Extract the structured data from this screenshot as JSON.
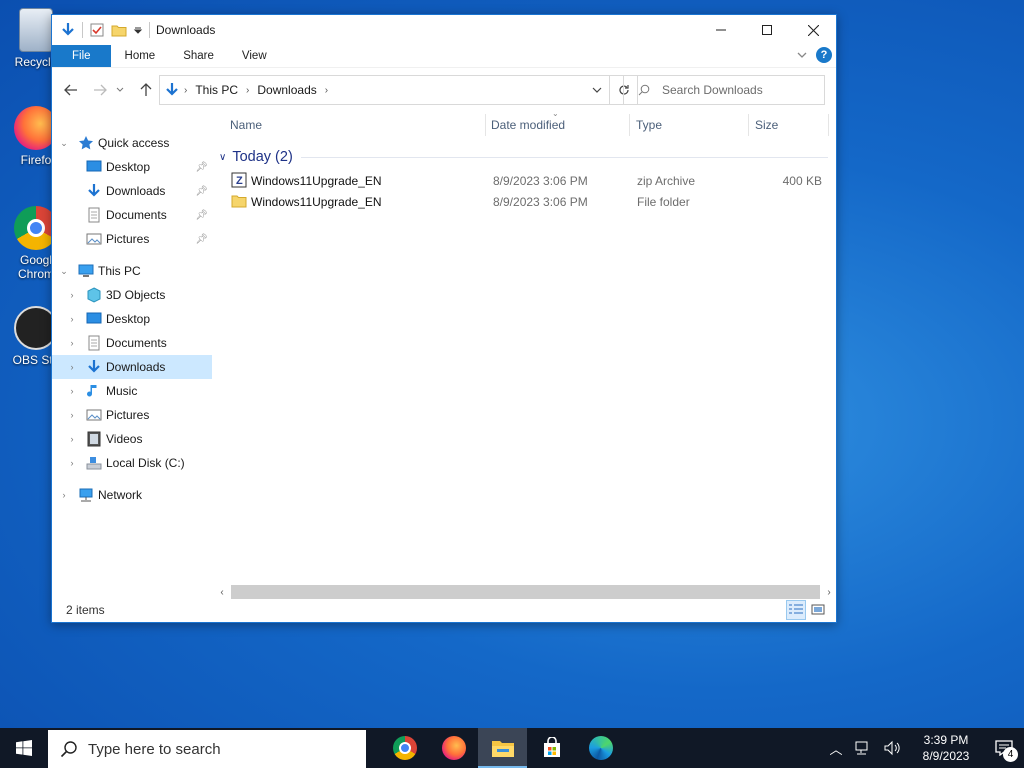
{
  "desktop": {
    "icons": [
      {
        "label": "Recycle",
        "icon": "recycle-bin-icon"
      },
      {
        "label": "Firefo",
        "icon": "firefox-icon"
      },
      {
        "label": "Googl",
        "label2": "Chrom",
        "icon": "chrome-icon"
      },
      {
        "label": "OBS Stu",
        "icon": "obs-icon"
      }
    ]
  },
  "window": {
    "title": "Downloads",
    "controls": {
      "minimize": "—",
      "maximize": "☐",
      "close": "✕"
    },
    "ribbon": {
      "tabs": [
        "File",
        "Home",
        "Share",
        "View"
      ],
      "help": "?"
    },
    "address": {
      "crumbs": [
        "This PC",
        "Downloads"
      ]
    },
    "search": {
      "placeholder": "Search Downloads"
    },
    "nav": {
      "quick_access": "Quick access",
      "qa_items": [
        "Desktop",
        "Downloads",
        "Documents",
        "Pictures"
      ],
      "this_pc": "This PC",
      "pc_items": [
        "3D Objects",
        "Desktop",
        "Documents",
        "Downloads",
        "Music",
        "Pictures",
        "Videos",
        "Local Disk (C:)"
      ],
      "network": "Network"
    },
    "columns": [
      "Name",
      "Date modified",
      "Type",
      "Size"
    ],
    "group": "Today (2)",
    "files": [
      {
        "name": "Windows11Upgrade_EN",
        "date": "8/9/2023 3:06 PM",
        "type": "zip Archive",
        "size": "400 KB",
        "icon": "zip-archive-icon"
      },
      {
        "name": "Windows11Upgrade_EN",
        "date": "8/9/2023 3:06 PM",
        "type": "File folder",
        "size": "",
        "icon": "folder-icon"
      }
    ],
    "status": "2 items"
  },
  "taskbar": {
    "search_placeholder": "Type here to search",
    "apps": [
      "chrome-icon",
      "firefox-icon",
      "file-explorer-icon",
      "store-icon",
      "edge-icon"
    ],
    "clock": {
      "time": "3:39 PM",
      "date": "8/9/2023"
    },
    "notifications": "4"
  }
}
